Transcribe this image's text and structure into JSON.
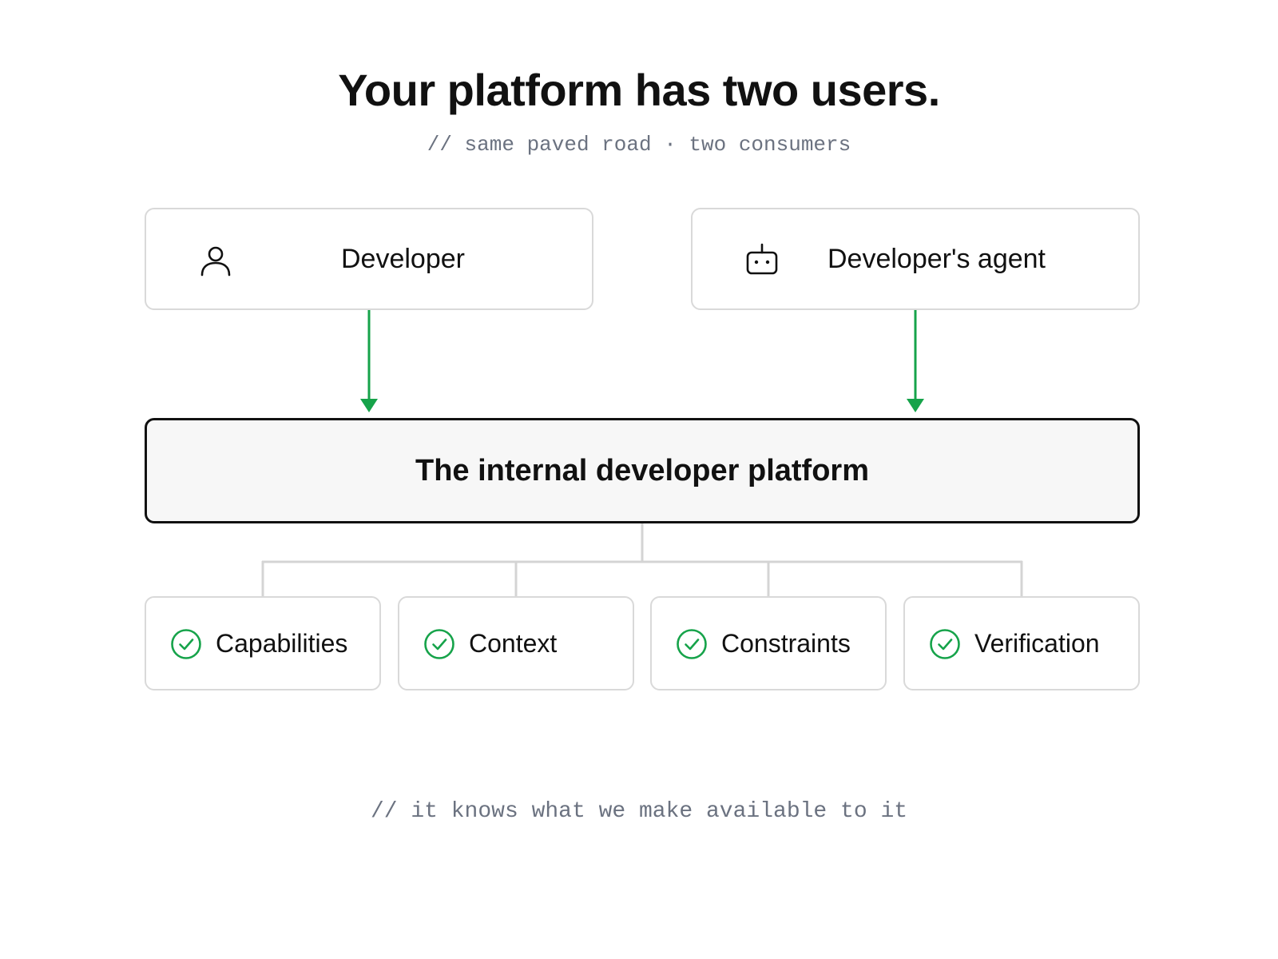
{
  "title": "Your platform has two users.",
  "subtitle": "// same paved road · two consumers",
  "users": [
    {
      "label": "Developer",
      "icon": "person-icon"
    },
    {
      "label": "Developer's agent",
      "icon": "robot-icon"
    }
  ],
  "platform": {
    "label": "The internal developer platform"
  },
  "pillars": [
    {
      "label": "Capabilities",
      "icon": "check-circle-icon"
    },
    {
      "label": "Context",
      "icon": "check-circle-icon"
    },
    {
      "label": "Constraints",
      "icon": "check-circle-icon"
    },
    {
      "label": "Verification",
      "icon": "check-circle-icon"
    }
  ],
  "footer": "// it knows what we make available to it",
  "colors": {
    "accent": "#16a34a",
    "border": "#d9d9d9",
    "text": "#111111",
    "muted": "#6b7280",
    "platform_bg": "#f7f7f7"
  }
}
